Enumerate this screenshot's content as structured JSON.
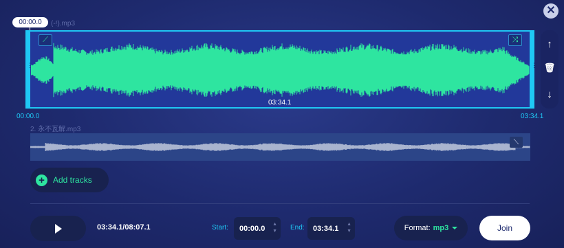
{
  "close": {
    "icon": "close-icon",
    "glyph": "✕"
  },
  "playhead": {
    "time": "00:00.0"
  },
  "tracks": [
    {
      "name": "(-!).mp3",
      "duration": "03:34.1",
      "start": "00:00.0",
      "end": "03:34.1",
      "fade_in_icon": "fade-in-icon",
      "fade_out_icon": "shuffle-icon",
      "wave_color": "#2ee5a0"
    },
    {
      "name": "2. 永不瓦解.mp3",
      "fade_out_icon": "fade-out-icon",
      "wave_color": "#a9b4cf"
    }
  ],
  "side_actions": [
    {
      "icon": "arrow-up-icon",
      "glyph": "↑"
    },
    {
      "icon": "trash-icon",
      "glyph": "🗑"
    },
    {
      "icon": "arrow-down-icon",
      "glyph": "↓"
    }
  ],
  "add_tracks": {
    "label": "Add tracks",
    "icon": "plus-icon"
  },
  "player": {
    "progress": "03:34.1/08:07.1",
    "play_icon": "play-icon"
  },
  "start": {
    "label": "Start:",
    "value": "00:00.0"
  },
  "end": {
    "label": "End:",
    "value": "03:34.1"
  },
  "format": {
    "label": "Format:",
    "value": "mp3"
  },
  "join": {
    "label": "Join"
  },
  "colors": {
    "accent": "#1fc8f5",
    "green": "#2ee5a0",
    "background": "#1e2a6e"
  }
}
